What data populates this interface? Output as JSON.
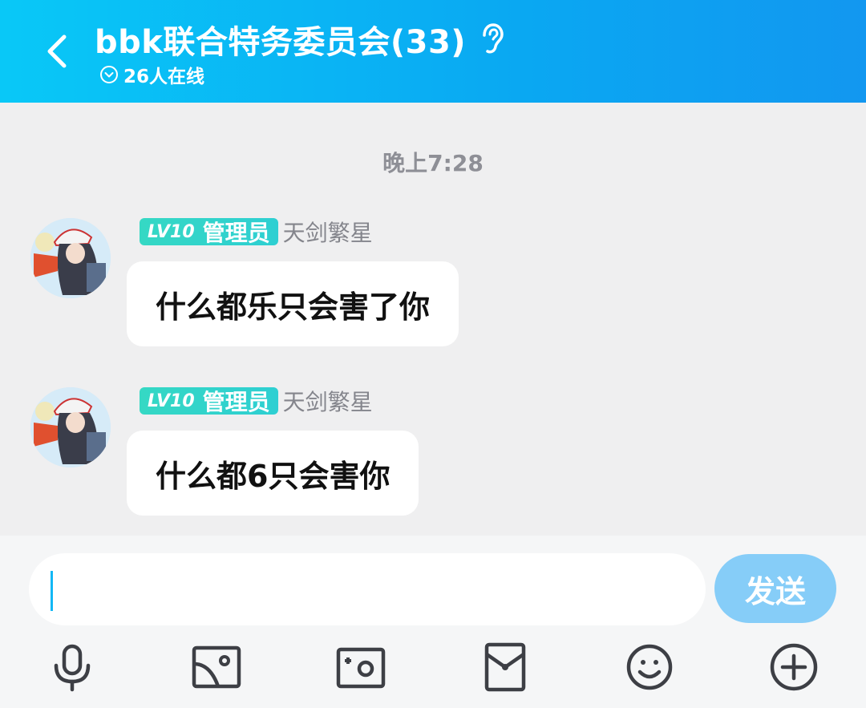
{
  "header": {
    "title": "bbk联合特务委员会(33)",
    "online_status": "26人在线",
    "back_icon": "chevron-left-icon",
    "ear_icon": "ear-icon"
  },
  "chat": {
    "timestamp": "晚上7:28",
    "messages": [
      {
        "level": "LV10",
        "role": "管理员",
        "sender": "天剑繁星",
        "text": "什么都乐只会害了你"
      },
      {
        "level": "LV10",
        "role": "管理员",
        "sender": "天剑繁星",
        "text": "什么都6只会害你"
      }
    ]
  },
  "composer": {
    "input_value": "",
    "send_label": "发送"
  },
  "toolbar": {
    "icons": [
      "microphone-icon",
      "image-icon",
      "camera-icon",
      "red-packet-icon",
      "emoji-icon",
      "plus-icon"
    ]
  },
  "colors": {
    "header_start": "#09c8f7",
    "header_end": "#1297f0",
    "badge": "#35d8c4",
    "send_button": "#86cdf8",
    "background": "#efeff0"
  }
}
